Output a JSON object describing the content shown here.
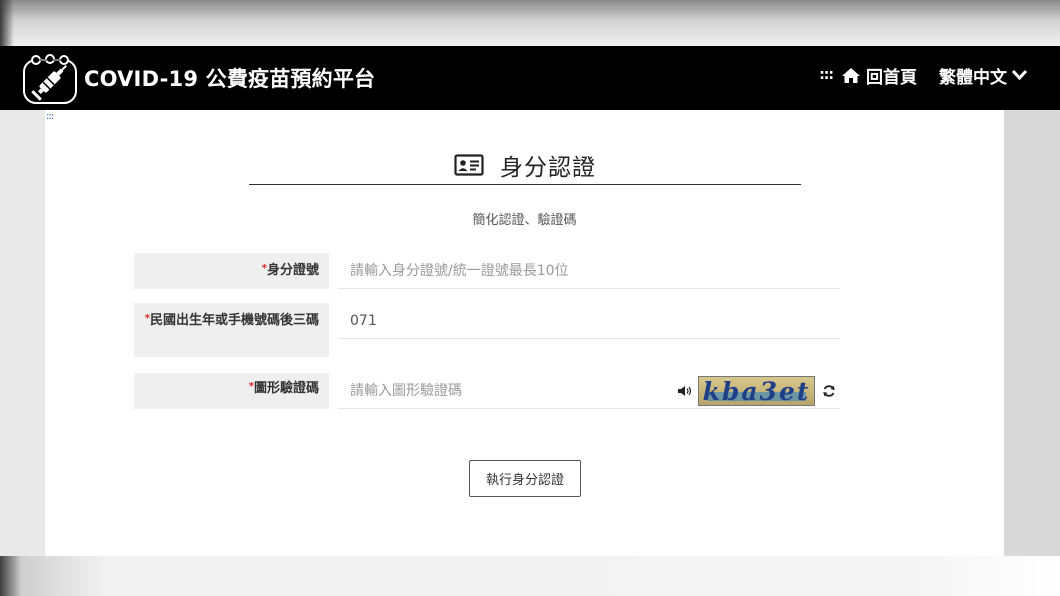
{
  "header": {
    "site_title": "COVID-19 公費疫苗預約平台",
    "access_key": ":::",
    "home_label": "回首頁",
    "language_label": "繁體中文"
  },
  "main": {
    "access_key": ":::",
    "heading": "身分認證",
    "subtitle": "簡化認證、驗證碼"
  },
  "form": {
    "required_mark": "*",
    "id_label": "身分證號",
    "id_placeholder": "請輸入身分證號/統一證號最長10位",
    "birth_label": "民國出生年或手機號碼後三碼",
    "birth_value": "071",
    "captcha_label": "圖形驗證碼",
    "captcha_placeholder": "請輸入圖形驗證碼",
    "captcha_text": "kba3et",
    "submit_label": "執行身分認證"
  },
  "icons": {
    "logo": "vaccine-syringe-icon",
    "home": "home-icon",
    "language": "chevron-down-icon",
    "heading": "id-card-icon",
    "audio": "speaker-icon",
    "refresh": "refresh-icon"
  },
  "colors": {
    "navbar_bg": "#000000",
    "required": "#e02020",
    "label_bg": "#efefef",
    "captcha_text": "#1f3f88"
  }
}
